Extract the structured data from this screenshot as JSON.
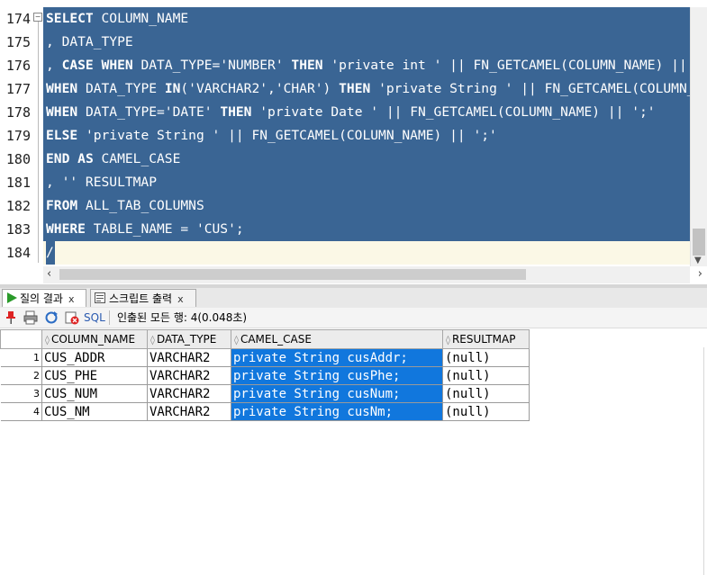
{
  "editor": {
    "line_numbers": [
      "174",
      "175",
      "176",
      "177",
      "178",
      "179",
      "180",
      "181",
      "182",
      "183",
      "184"
    ],
    "lines": [
      [
        {
          "t": "SELECT",
          "k": true
        },
        {
          "t": " COLUMN_NAME"
        }
      ],
      [
        {
          "t": ", DATA_TYPE"
        }
      ],
      [
        {
          "t": ", "
        },
        {
          "t": "CASE",
          "k": true
        },
        {
          "t": " "
        },
        {
          "t": "WHEN",
          "k": true
        },
        {
          "t": " DATA_TYPE='NUMBER' "
        },
        {
          "t": "THEN",
          "k": true
        },
        {
          "t": " 'private int ' || FN_GETCAMEL(COLUMN_NAME) || ';'"
        }
      ],
      [
        {
          "t": "WHEN",
          "k": true
        },
        {
          "t": " DATA_TYPE "
        },
        {
          "t": "IN",
          "k": true
        },
        {
          "t": "('VARCHAR2','CHAR') "
        },
        {
          "t": "THEN",
          "k": true
        },
        {
          "t": " 'private String ' || FN_GETCAMEL(COLUMN_NAME) || ';'"
        }
      ],
      [
        {
          "t": "WHEN",
          "k": true
        },
        {
          "t": " DATA_TYPE='DATE' "
        },
        {
          "t": "THEN",
          "k": true
        },
        {
          "t": " 'private Date ' || FN_GETCAMEL(COLUMN_NAME) || ';'"
        }
      ],
      [
        {
          "t": "ELSE",
          "k": true
        },
        {
          "t": " 'private String ' || FN_GETCAMEL(COLUMN_NAME) || ';'"
        }
      ],
      [
        {
          "t": "END",
          "k": true
        },
        {
          "t": " "
        },
        {
          "t": "AS",
          "k": true
        },
        {
          "t": " CAMEL_CASE"
        }
      ],
      [
        {
          "t": ", '' RESULTMAP"
        }
      ],
      [
        {
          "t": "FROM",
          "k": true
        },
        {
          "t": " ALL_TAB_COLUMNS"
        }
      ],
      [
        {
          "t": "WHERE",
          "k": true
        },
        {
          "t": " TABLE_NAME = 'CUS';"
        }
      ],
      [
        {
          "t": "/"
        }
      ]
    ]
  },
  "tabs": [
    {
      "label": "질의 결과",
      "icon": "play-icon",
      "close": "x",
      "active": true
    },
    {
      "label": "스크립트 출력",
      "icon": "script-output-icon",
      "close": "x",
      "active": false
    }
  ],
  "toolbar": {
    "sql_label": "SQL",
    "status": "인출된 모든 행: 4(0.048초)"
  },
  "results": {
    "columns": [
      "COLUMN_NAME",
      "DATA_TYPE",
      "CAMEL_CASE",
      "RESULTMAP"
    ],
    "rows": [
      {
        "n": "1",
        "cells": [
          "CUS_ADDR",
          "VARCHAR2",
          "private String cusAddr;",
          "(null)"
        ]
      },
      {
        "n": "2",
        "cells": [
          "CUS_PHE",
          "VARCHAR2",
          "private String cusPhe;",
          "(null)"
        ]
      },
      {
        "n": "3",
        "cells": [
          "CUS_NUM",
          "VARCHAR2",
          "private String cusNum;",
          "(null)"
        ]
      },
      {
        "n": "4",
        "cells": [
          "CUS_NM",
          "VARCHAR2",
          "private String cusNm;",
          "(null)"
        ]
      }
    ]
  },
  "colors": {
    "selection": "#3a6594",
    "cell_selection": "#1177dd"
  }
}
